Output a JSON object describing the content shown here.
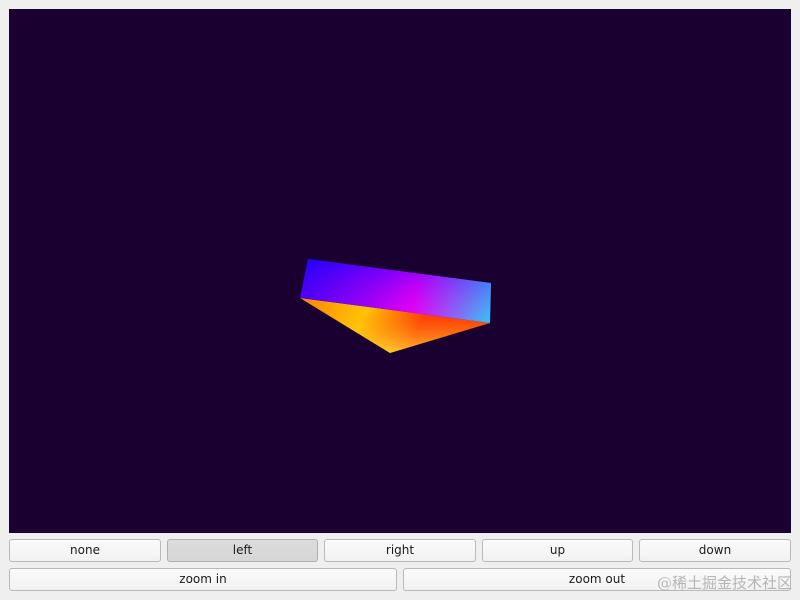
{
  "viewport": {
    "background": "#190030"
  },
  "controls": {
    "rotation_buttons": [
      "none",
      "left",
      "right",
      "up",
      "down"
    ],
    "active_rotation": "left",
    "zoom_in_label": "zoom in",
    "zoom_out_label": "zoom out"
  },
  "watermark": "@稀土掘金技术社区"
}
